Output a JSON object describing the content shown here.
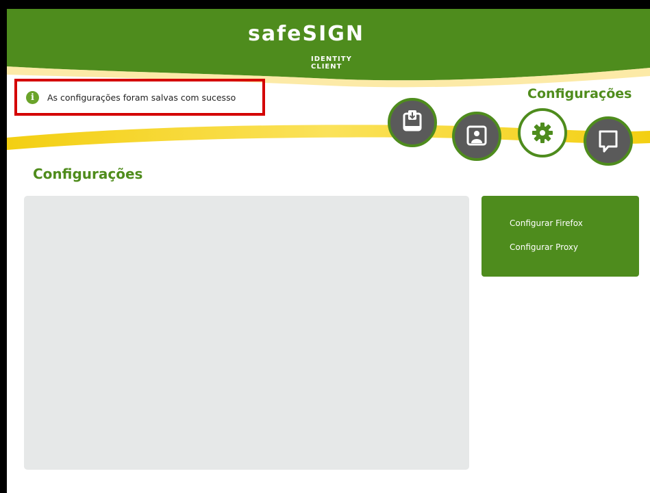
{
  "header": {
    "logo_text": "safeSIGN",
    "logo_subtitle": "IDENTITY CLIENT",
    "section_title": "Configurações",
    "colors": {
      "brand_green": "#4e8c1d",
      "accent_yellow": "#f5d21c"
    }
  },
  "notification": {
    "icon": "info-icon",
    "message": "As configurações foram salvas com sucesso",
    "highlight_color": "#d40000"
  },
  "nav": {
    "buttons": [
      {
        "name": "download-icon",
        "active": false
      },
      {
        "name": "certificate-icon",
        "active": false
      },
      {
        "name": "gear-icon",
        "active": true
      },
      {
        "name": "speech-bubble-icon",
        "active": false
      }
    ]
  },
  "main": {
    "title": "Configurações"
  },
  "sidebar": {
    "items": [
      {
        "label": "Configurar Firefox"
      },
      {
        "label": "Configurar Proxy"
      }
    ]
  }
}
